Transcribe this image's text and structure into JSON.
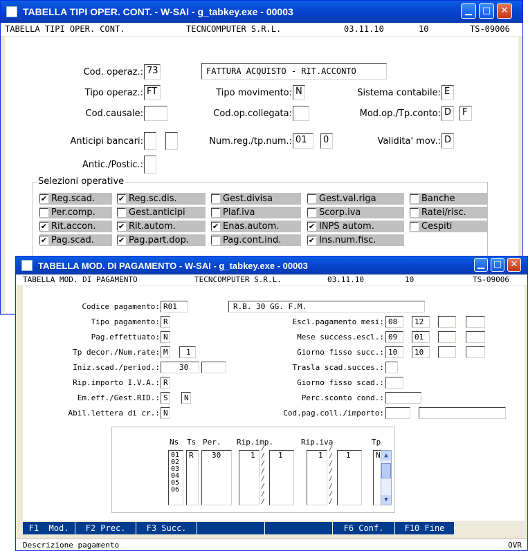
{
  "win1": {
    "title": "TABELLA TIPI OPER. CONT. - W-SAI - g_tabkey.exe       - 00003",
    "header": {
      "name": "TABELLA TIPI OPER. CONT.",
      "company": "TECNCOMPUTER S.R.L.",
      "date": "03.11.10",
      "num": "10",
      "code": "TS-09006"
    },
    "fields": {
      "cod_operaz_label": "Cod. operaz.:",
      "cod_operaz": "73",
      "descrizione": "FATTURA ACQUISTO - RIT.ACCONTO",
      "tipo_operaz_label": "Tipo operaz.:",
      "tipo_operaz": "FT",
      "tipo_movimento_label": "Tipo movimento:",
      "tipo_movimento": "N",
      "sistema_contabile_label": "Sistema contabile:",
      "sistema_contabile": "E",
      "cod_causale_label": "Cod.causale:",
      "cod_causale": "",
      "cod_op_collegata_label": "Cod.op.collegata:",
      "cod_op_collegata": "",
      "mod_op_label": "Mod.op./Tp.conto:",
      "mod_op": "D",
      "tp_conto": "F",
      "anticipi_label": "Anticipi bancari:",
      "anticipi1": "",
      "anticipi2": "",
      "num_reg_label": "Num.reg./tp.num.:",
      "num_reg": "01",
      "tp_num": "0",
      "validita_label": "Validita' mov.:",
      "validita": "D",
      "antic_postic_label": "Antic./Postic.:",
      "antic_postic": ""
    },
    "selezioni_title": "Selezioni operative",
    "checks": [
      {
        "label": "Reg.scad.",
        "checked": true
      },
      {
        "label": "Reg.sc.dis.",
        "checked": true
      },
      {
        "label": "Gest.divisa",
        "checked": false
      },
      {
        "label": "Gest.val.riga",
        "checked": false
      },
      {
        "label": "Banche",
        "checked": false
      },
      {
        "label": "Per.comp.",
        "checked": false
      },
      {
        "label": "Gest.anticipi",
        "checked": false
      },
      {
        "label": "Plaf.iva",
        "checked": false
      },
      {
        "label": "Scorp.iva",
        "checked": false
      },
      {
        "label": "Ratei/risc.",
        "checked": false
      },
      {
        "label": "Rit.accon.",
        "checked": true
      },
      {
        "label": "Rit.autom.",
        "checked": true
      },
      {
        "label": "Enas.autom.",
        "checked": true
      },
      {
        "label": "INPS autom.",
        "checked": true
      },
      {
        "label": "Cespiti",
        "checked": false
      },
      {
        "label": "Pag.scad.",
        "checked": true
      },
      {
        "label": "Pag.part.dop.",
        "checked": true
      },
      {
        "label": "Pag.cont.ind.",
        "checked": false
      },
      {
        "label": "Ins.num.fisc.",
        "checked": true
      }
    ]
  },
  "win2": {
    "title": "TABELLA MOD. DI PAGAMENTO - W-SAI - g_tabkey.exe       - 00003",
    "header": {
      "name": "TABELLA MOD. DI PAGAMENTO",
      "company": "TECNCOMPUTER S.R.L.",
      "date": "03.11.10",
      "num": "10",
      "code": "TS-09006"
    },
    "fields": {
      "codice_label": "Codice pagamento:",
      "codice": "R01",
      "descrizione": "R.B. 30 GG. F.M.",
      "tipo_label": "Tipo pagamento:",
      "tipo": "R",
      "pag_eff_label": "Pag.effettuato:",
      "pag_eff": "N",
      "tp_decor_label": "Tp decor./Num.rate:",
      "tp_decor": "M",
      "num_rate": "1",
      "iniz_scad_label": "Iniz.scad./period.:",
      "iniz_scad": "30",
      "period": "",
      "rip_iva_label": "Rip.importo I.V.A.:",
      "rip_iva": "R",
      "em_eff_label": "Em.eff./Gest.RID.:",
      "em_eff": "S",
      "gest_rid": "N",
      "abil_label": "Abil.lettera di cr.:",
      "abil": "N",
      "escl_mesi_label": "Escl.pagamento mesi:",
      "escl1": "08",
      "escl2": "12",
      "escl3": "",
      "escl4": "",
      "mese_succ_label": "Mese success.escl.:",
      "mese1": "09",
      "mese2": "01",
      "mese3": "",
      "mese4": "",
      "giorno_succ_label": "Giorno fisso succ.:",
      "gs1": "10",
      "gs2": "10",
      "gs3": "",
      "gs4": "",
      "trasla_label": "Trasla scad.succes.:",
      "trasla": "",
      "giorno_scad_label": "Giorno fisso scad.:",
      "giorno_scad": "",
      "perc_label": "Perc.sconto cond.:",
      "perc": "",
      "cod_pag_coll_label": "Cod.pag.coll./importo:",
      "cod_pag_coll": "",
      "importo": ""
    },
    "grid": {
      "headers": {
        "ns": "Ns",
        "ts": "Ts",
        "per": "Per.",
        "rip_imp": "Rip.imp.",
        "rip_iva": "Rip.iva",
        "tp": "Tp"
      },
      "ns": [
        "01",
        "02",
        "03",
        "04",
        "05",
        "06"
      ],
      "ts": "R",
      "per": "30",
      "rip_imp_a": "1",
      "rip_imp_b": "1",
      "rip_iva_a": "1",
      "rip_iva_b": "1",
      "tp": "N"
    },
    "fkeys": [
      "F1  Mod.",
      "F2 Prec.",
      "F3 Succ.",
      "",
      "",
      "F6 Conf.",
      "F10 Fine"
    ],
    "status_left": "Descrizione pagamento",
    "status_right": "OVR"
  }
}
